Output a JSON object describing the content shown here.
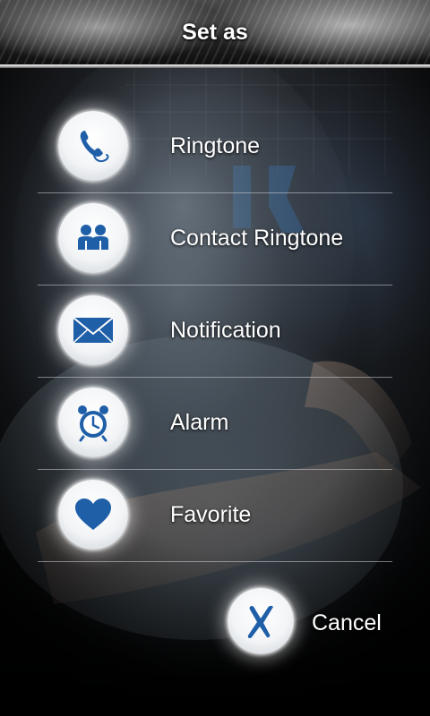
{
  "header": {
    "title": "Set as"
  },
  "menu": {
    "items": [
      {
        "label": "Ringtone",
        "icon": "phone-icon"
      },
      {
        "label": "Contact Ringtone",
        "icon": "contacts-icon"
      },
      {
        "label": "Notification",
        "icon": "envelope-icon"
      },
      {
        "label": "Alarm",
        "icon": "alarm-clock-icon"
      },
      {
        "label": "Favorite",
        "icon": "heart-icon"
      }
    ]
  },
  "cancel": {
    "label": "Cancel",
    "icon": "close-x-icon"
  },
  "colors": {
    "icon_blue": "#1f5fa8",
    "text": "#ffffff",
    "icon_background": "#ffffff"
  }
}
